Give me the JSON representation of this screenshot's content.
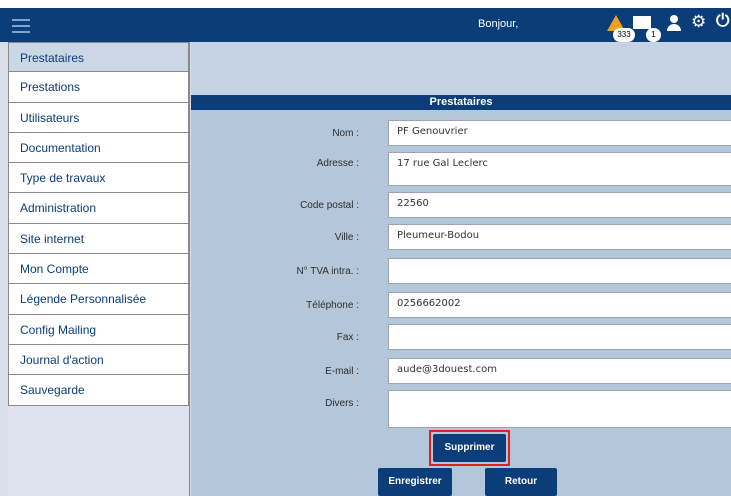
{
  "header": {
    "greeting": "Bonjour,",
    "alerts_count": "333",
    "messages_count": "1",
    "colors": {
      "bar": "#0b3d78",
      "alert": "#f0a020"
    },
    "icons": [
      "menu-icon",
      "warning-icon",
      "message-icon",
      "user-icon",
      "gear-icon",
      "power-icon"
    ]
  },
  "sidebar": {
    "items": [
      {
        "label": "Prestataires"
      },
      {
        "label": "Prestations"
      },
      {
        "label": "Utilisateurs"
      },
      {
        "label": "Documentation"
      },
      {
        "label": "Type de travaux"
      },
      {
        "label": "Administration"
      },
      {
        "label": "Site internet"
      },
      {
        "label": "Mon Compte"
      },
      {
        "label": "Légende Personnalisée"
      },
      {
        "label": "Config Mailing"
      },
      {
        "label": "Journal d'action"
      },
      {
        "label": "Sauvegarde"
      }
    ]
  },
  "form": {
    "title": "Prestataires",
    "fields": [
      {
        "label": "Nom :",
        "value": "PF Genouvrier"
      },
      {
        "label": "Adresse :",
        "value": "17 rue Gal Leclerc"
      },
      {
        "label": "Code postal :",
        "value": "22560"
      },
      {
        "label": "Ville :",
        "value": "Pleumeur-Bodou"
      },
      {
        "label": "N° TVA intra. :",
        "value": ""
      },
      {
        "label": "Téléphone :",
        "value": "0256662002"
      },
      {
        "label": "Fax :",
        "value": ""
      },
      {
        "label": "E-mail :",
        "value": "aude@3douest.com"
      },
      {
        "label": "Divers :",
        "value": ""
      }
    ],
    "buttons": {
      "delete": "Supprimer",
      "save": "Enregistrer",
      "back": "Retour"
    }
  }
}
